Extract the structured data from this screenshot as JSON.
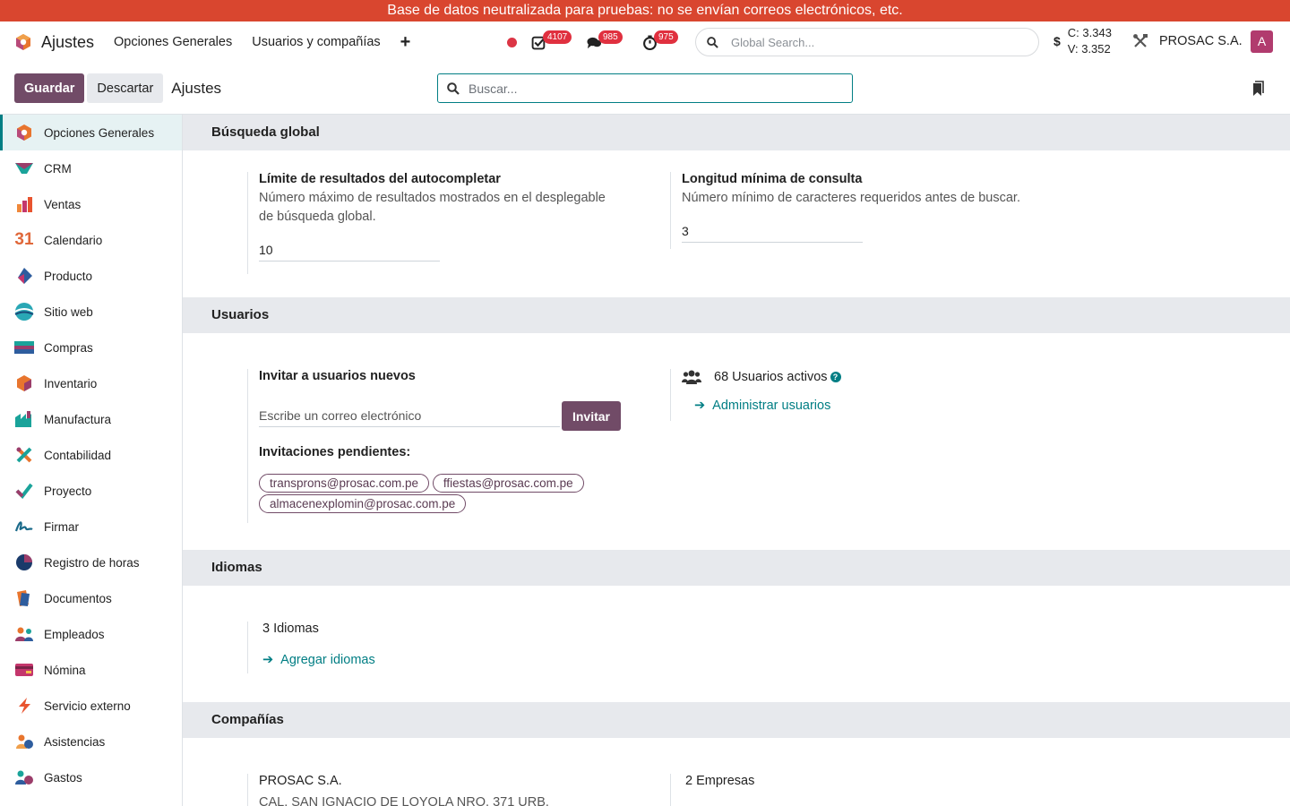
{
  "banner": {
    "text": "Base de datos neutralizada para pruebas: no se envían correos electrónicos, etc."
  },
  "navbar": {
    "app_name": "Ajustes",
    "menu": [
      "Opciones Generales",
      "Usuarios y compañías"
    ],
    "badges": {
      "activities": "4107",
      "messages": "985",
      "timers": "975"
    },
    "global_search_placeholder": "Global Search...",
    "currency_symbol": "$",
    "rate_c": "C: 3.343",
    "rate_v": "V: 3.352",
    "company": "PROSAC S.A.",
    "avatar_letter": "A"
  },
  "control": {
    "save_label": "Guardar",
    "discard_label": "Descartar",
    "breadcrumb": "Ajustes",
    "search_placeholder": "Buscar..."
  },
  "sidebar": {
    "items": [
      {
        "label": "Opciones Generales",
        "icon": "settings-app-icon"
      },
      {
        "label": "CRM",
        "icon": "crm-app-icon"
      },
      {
        "label": "Ventas",
        "icon": "sales-app-icon"
      },
      {
        "label": "Calendario",
        "icon": "calendar-app-icon"
      },
      {
        "label": "Producto",
        "icon": "product-app-icon"
      },
      {
        "label": "Sitio web",
        "icon": "website-app-icon"
      },
      {
        "label": "Compras",
        "icon": "purchase-app-icon"
      },
      {
        "label": "Inventario",
        "icon": "inventory-app-icon"
      },
      {
        "label": "Manufactura",
        "icon": "manufacturing-app-icon"
      },
      {
        "label": "Contabilidad",
        "icon": "accounting-app-icon"
      },
      {
        "label": "Proyecto",
        "icon": "project-app-icon"
      },
      {
        "label": "Firmar",
        "icon": "sign-app-icon"
      },
      {
        "label": "Registro de horas",
        "icon": "timesheet-app-icon"
      },
      {
        "label": "Documentos",
        "icon": "documents-app-icon"
      },
      {
        "label": "Empleados",
        "icon": "employees-app-icon"
      },
      {
        "label": "Nómina",
        "icon": "payroll-app-icon"
      },
      {
        "label": "Servicio externo",
        "icon": "field-service-app-icon"
      },
      {
        "label": "Asistencias",
        "icon": "attendances-app-icon"
      },
      {
        "label": "Gastos",
        "icon": "expenses-app-icon"
      }
    ]
  },
  "sections": {
    "global_search": {
      "title": "Búsqueda global",
      "autocomplete_title": "Límite de resultados del autocompletar",
      "autocomplete_desc": "Número máximo de resultados mostrados en el desplegable de búsqueda global.",
      "autocomplete_value": "10",
      "minlen_title": "Longitud mínima de consulta",
      "minlen_desc": "Número mínimo de caracteres requeridos antes de buscar.",
      "minlen_value": "3"
    },
    "users": {
      "title": "Usuarios",
      "invite_title": "Invitar a usuarios nuevos",
      "email_placeholder": "Escribe un correo electrónico",
      "invite_button": "Invitar",
      "pending_title": "Invitaciones pendientes:",
      "pending": [
        "transprons@prosac.com.pe",
        "ffiestas@prosac.com.pe",
        "almacenexplomin@prosac.com.pe"
      ],
      "active_users": "68 Usuarios activos",
      "manage_link": "Administrar usuarios"
    },
    "languages": {
      "title": "Idiomas",
      "count": "3 Idiomas",
      "add_link": "Agregar idiomas"
    },
    "companies": {
      "title": "Compañías",
      "company_name": "PROSAC S.A.",
      "company_address": "CAL. SAN IGNACIO DE LOYOLA NRO. 371 URB.",
      "count": "2 Empresas"
    }
  },
  "colors": {
    "primary": "#714b67",
    "accent": "#017e84",
    "banner": "#d9462f"
  }
}
